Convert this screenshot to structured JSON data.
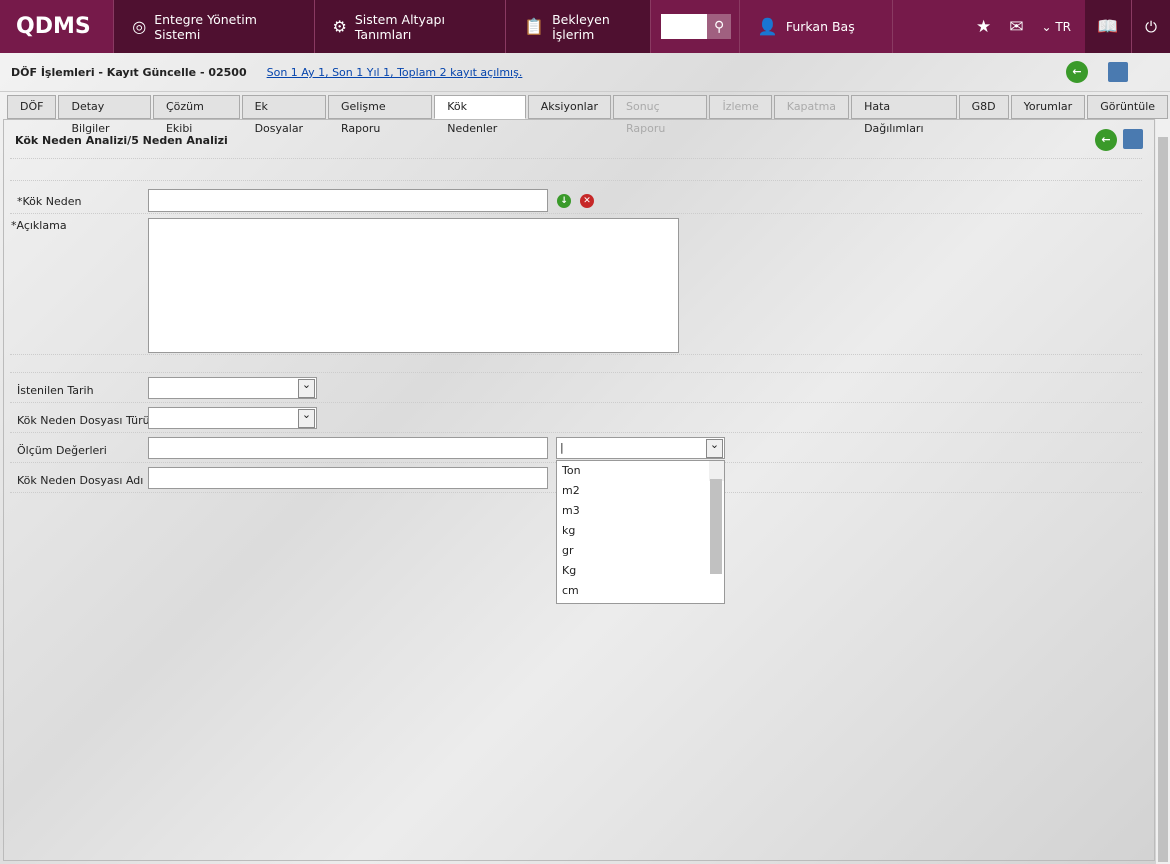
{
  "header": {
    "logo": "QDMS",
    "nav": [
      {
        "label": "Entegre Yönetim Sistemi",
        "icon": "q-icon"
      },
      {
        "label": "Sistem Altyapı Tanımları",
        "icon": "gear-icon"
      },
      {
        "label": "Bekleyen İşlerim",
        "icon": "clipboard-icon"
      }
    ],
    "user": "Furkan Baş",
    "lang": "TR"
  },
  "page": {
    "title": "DÖF İşlemleri - Kayıt Güncelle - 02500",
    "summary": "Son 1 Ay 1, Son 1 Yıl 1, Toplam 2 kayıt açılmış."
  },
  "tabs": [
    {
      "label": "DÖF"
    },
    {
      "label": "Detay Bilgiler"
    },
    {
      "label": "Çözüm Ekibi"
    },
    {
      "label": "Ek Dosyalar"
    },
    {
      "label": "Gelişme Raporu"
    },
    {
      "label": "Kök Nedenler",
      "active": true
    },
    {
      "label": "Aksiyonlar"
    },
    {
      "label": "Sonuç Raporu",
      "disabled": true
    },
    {
      "label": "İzleme",
      "disabled": true
    },
    {
      "label": "Kapatma",
      "disabled": true
    },
    {
      "label": "Hata Dağılımları"
    },
    {
      "label": "G8D"
    },
    {
      "label": "Yorumlar"
    },
    {
      "label": "Görüntüle"
    }
  ],
  "form": {
    "title": "Kök Neden Analizi/5 Neden Analizi",
    "kok_neden": "*Kök Neden",
    "aciklama": "*Açıklama",
    "istenilen_tarih": "İstenilen Tarih",
    "dosya_turu": "Kök Neden Dosyası Türü",
    "olcum": "Ölçüm Değerleri",
    "dosya_adi": "Kök Neden Dosyası Adı"
  },
  "unit_options": [
    "Ton",
    "m2",
    "m3",
    "kg",
    "gr",
    "Kg",
    "cm"
  ]
}
